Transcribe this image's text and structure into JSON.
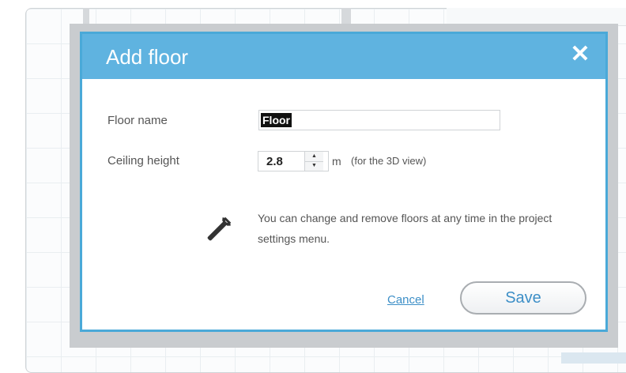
{
  "dialog": {
    "title": "Add floor",
    "close_icon": "close-icon"
  },
  "form": {
    "floor_name_label": "Floor name",
    "floor_name_value": "Floor",
    "ceiling_height_label": "Ceiling height",
    "ceiling_height_value": "2.8",
    "ceiling_unit": "m",
    "ceiling_note": "(for the 3D view)"
  },
  "info": {
    "icon": "wrench-icon",
    "text": "You can change and remove floors at any time in the project settings menu."
  },
  "actions": {
    "cancel_label": "Cancel",
    "save_label": "Save"
  },
  "colors": {
    "header": "#5fb3e0",
    "border": "#4aa9d8",
    "link": "#3d8fc7"
  }
}
